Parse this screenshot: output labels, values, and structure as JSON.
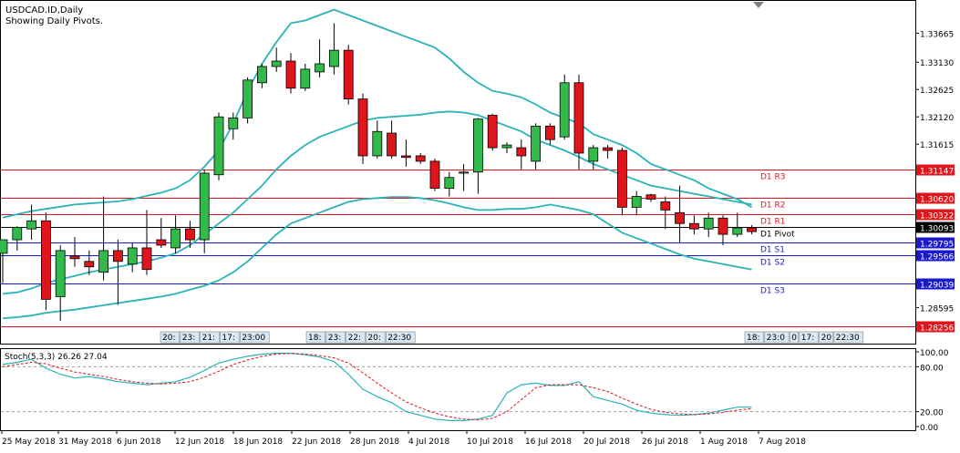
{
  "header": {
    "symbol_line": "USDCAD.ID,Daily",
    "sub_line": "Showing Daily Pivots."
  },
  "colors": {
    "bull": "#31b94a",
    "bear": "#e0141b",
    "band": "#2ab3b8",
    "resistance": "#e0141b",
    "support": "#1a1acc",
    "pivot": "#000000",
    "stoch_main": "#2ab3b8",
    "stoch_signal": "#e0141b"
  },
  "price_axis": {
    "ticks": [
      "1.33665",
      "1.33130",
      "1.32625",
      "1.32120",
      "1.31615",
      "1.28595"
    ]
  },
  "pivots": [
    {
      "name": "D1 R3",
      "value": "1.31147",
      "kind": "resistance"
    },
    {
      "name": "D1 R2",
      "value": "1.30620",
      "kind": "resistance"
    },
    {
      "name": "D1 R1",
      "value": "1.30322",
      "kind": "resistance"
    },
    {
      "name": "D1 Pivot",
      "value": "1.30093",
      "kind": "pivot"
    },
    {
      "name": "D1 S1",
      "value": "1.29795",
      "kind": "support"
    },
    {
      "name": "D1 S2",
      "value": "1.29566",
      "kind": "support"
    },
    {
      "name": "D1 S3",
      "value": "1.29039",
      "kind": "support"
    },
    {
      "name": "",
      "value": "1.28256",
      "kind": "resistance"
    }
  ],
  "session_labels_left": [
    "20:",
    "23:",
    "21:",
    "17:",
    "23:00"
  ],
  "session_labels_mid": [
    "18:",
    "23:",
    "22:",
    "20:",
    "22:30"
  ],
  "session_labels_right": [
    "18:",
    "23:0",
    "0",
    "17:",
    "20",
    "22:30"
  ],
  "stochastic": {
    "title": "Stoch(5,3,3) 26.26 27.04",
    "axis_ticks": [
      "100.00",
      "80.00",
      "20.00",
      "0.00"
    ]
  },
  "date_axis": {
    "labels": [
      "25 May 2018",
      "31 May 2018",
      "6 Jun 2018",
      "12 Jun 2018",
      "18 Jun 2018",
      "22 Jun 2018",
      "28 Jun 2018",
      "4 Jul 2018",
      "10 Jul 2018",
      "16 Jul 2018",
      "20 Jul 2018",
      "26 Jul 2018",
      "1 Aug 2018",
      "7 Aug 2018"
    ]
  },
  "chart_data": {
    "type": "candlestick",
    "symbol": "USDCAD.ID",
    "timeframe": "Daily",
    "candles": [
      {
        "o": 1.296,
        "h": 1.2985,
        "l": 1.2905,
        "c": 1.2985
      },
      {
        "o": 1.2985,
        "h": 1.301,
        "l": 1.2965,
        "c": 1.3008
      },
      {
        "o": 1.3005,
        "h": 1.305,
        "l": 1.2985,
        "c": 1.302
      },
      {
        "o": 1.302,
        "h": 1.3035,
        "l": 1.2855,
        "c": 1.2875
      },
      {
        "o": 1.288,
        "h": 1.2975,
        "l": 1.2835,
        "c": 1.2965
      },
      {
        "o": 1.2955,
        "h": 1.299,
        "l": 1.2935,
        "c": 1.295
      },
      {
        "o": 1.2945,
        "h": 1.2965,
        "l": 1.292,
        "c": 1.2935
      },
      {
        "o": 1.2925,
        "h": 1.3065,
        "l": 1.291,
        "c": 1.2965
      },
      {
        "o": 1.2965,
        "h": 1.2985,
        "l": 1.2865,
        "c": 1.2945
      },
      {
        "o": 1.294,
        "h": 1.298,
        "l": 1.2925,
        "c": 1.297
      },
      {
        "o": 1.297,
        "h": 1.304,
        "l": 1.292,
        "c": 1.293
      },
      {
        "o": 1.2985,
        "h": 1.3025,
        "l": 1.297,
        "c": 1.2975
      },
      {
        "o": 1.297,
        "h": 1.303,
        "l": 1.296,
        "c": 1.3005
      },
      {
        "o": 1.3005,
        "h": 1.302,
        "l": 1.297,
        "c": 1.2985
      },
      {
        "o": 1.2985,
        "h": 1.3115,
        "l": 1.296,
        "c": 1.3108
      },
      {
        "o": 1.3105,
        "h": 1.322,
        "l": 1.3095,
        "c": 1.3212
      },
      {
        "o": 1.319,
        "h": 1.322,
        "l": 1.317,
        "c": 1.321
      },
      {
        "o": 1.321,
        "h": 1.3285,
        "l": 1.32,
        "c": 1.328
      },
      {
        "o": 1.3275,
        "h": 1.331,
        "l": 1.3265,
        "c": 1.3305
      },
      {
        "o": 1.3305,
        "h": 1.334,
        "l": 1.3295,
        "c": 1.3315
      },
      {
        "o": 1.3315,
        "h": 1.333,
        "l": 1.3255,
        "c": 1.3265
      },
      {
        "o": 1.3265,
        "h": 1.331,
        "l": 1.326,
        "c": 1.33
      },
      {
        "o": 1.3295,
        "h": 1.3355,
        "l": 1.3285,
        "c": 1.331
      },
      {
        "o": 1.3305,
        "h": 1.3385,
        "l": 1.329,
        "c": 1.3335
      },
      {
        "o": 1.3335,
        "h": 1.3345,
        "l": 1.3235,
        "c": 1.3245
      },
      {
        "o": 1.3245,
        "h": 1.3255,
        "l": 1.3125,
        "c": 1.314
      },
      {
        "o": 1.314,
        "h": 1.3205,
        "l": 1.3135,
        "c": 1.3185
      },
      {
        "o": 1.3182,
        "h": 1.3205,
        "l": 1.3135,
        "c": 1.314
      },
      {
        "o": 1.314,
        "h": 1.317,
        "l": 1.312,
        "c": 1.3137
      },
      {
        "o": 1.314,
        "h": 1.3145,
        "l": 1.3125,
        "c": 1.313
      },
      {
        "o": 1.313,
        "h": 1.3135,
        "l": 1.3075,
        "c": 1.308
      },
      {
        "o": 1.308,
        "h": 1.311,
        "l": 1.3065,
        "c": 1.31
      },
      {
        "o": 1.3108,
        "h": 1.3125,
        "l": 1.3075,
        "c": 1.311
      },
      {
        "o": 1.311,
        "h": 1.321,
        "l": 1.307,
        "c": 1.3208
      },
      {
        "o": 1.3215,
        "h": 1.3218,
        "l": 1.315,
        "c": 1.3155
      },
      {
        "o": 1.3155,
        "h": 1.3165,
        "l": 1.3145,
        "c": 1.316
      },
      {
        "o": 1.3155,
        "h": 1.317,
        "l": 1.3115,
        "c": 1.314
      },
      {
        "o": 1.313,
        "h": 1.32,
        "l": 1.3115,
        "c": 1.3195
      },
      {
        "o": 1.3195,
        "h": 1.32,
        "l": 1.316,
        "c": 1.317
      },
      {
        "o": 1.3175,
        "h": 1.329,
        "l": 1.317,
        "c": 1.3275
      },
      {
        "o": 1.3275,
        "h": 1.329,
        "l": 1.3115,
        "c": 1.3145
      },
      {
        "o": 1.313,
        "h": 1.316,
        "l": 1.3115,
        "c": 1.3155
      },
      {
        "o": 1.3155,
        "h": 1.316,
        "l": 1.3135,
        "c": 1.315
      },
      {
        "o": 1.315,
        "h": 1.3155,
        "l": 1.303,
        "c": 1.3045
      },
      {
        "o": 1.3045,
        "h": 1.3075,
        "l": 1.303,
        "c": 1.3065
      },
      {
        "o": 1.3068,
        "h": 1.307,
        "l": 1.3055,
        "c": 1.306
      },
      {
        "o": 1.3055,
        "h": 1.3065,
        "l": 1.3005,
        "c": 1.304
      },
      {
        "o": 1.3035,
        "h": 1.3085,
        "l": 1.298,
        "c": 1.3015
      },
      {
        "o": 1.3015,
        "h": 1.303,
        "l": 1.2995,
        "c": 1.3005
      },
      {
        "o": 1.3005,
        "h": 1.3035,
        "l": 1.299,
        "c": 1.3025
      },
      {
        "o": 1.3025,
        "h": 1.303,
        "l": 1.2975,
        "c": 1.2995
      },
      {
        "o": 1.2995,
        "h": 1.3035,
        "l": 1.299,
        "c": 1.3007
      },
      {
        "o": 1.3007,
        "h": 1.3012,
        "l": 1.2995,
        "c": 1.3
      }
    ],
    "bollinger": {
      "upper": [
        1.3026,
        1.3032,
        1.3038,
        1.3042,
        1.3046,
        1.305,
        1.3052,
        1.3054,
        1.3056,
        1.306,
        1.3066,
        1.3072,
        1.308,
        1.3095,
        1.312,
        1.315,
        1.32,
        1.326,
        1.331,
        1.335,
        1.3385,
        1.339,
        1.34,
        1.341,
        1.34,
        1.339,
        1.338,
        1.337,
        1.336,
        1.335,
        1.334,
        1.332,
        1.3295,
        1.3275,
        1.326,
        1.3255,
        1.3248,
        1.3235,
        1.322,
        1.321,
        1.32,
        1.318,
        1.317,
        1.316,
        1.3145,
        1.3125,
        1.3115,
        1.3105,
        1.3095,
        1.308,
        1.307,
        1.306,
        1.3045
      ],
      "middle": [
        1.2885,
        1.2888,
        1.2895,
        1.2905,
        1.2912,
        1.2918,
        1.2925,
        1.293,
        1.2935,
        1.294,
        1.2945,
        1.2952,
        1.296,
        1.2975,
        1.2995,
        1.3015,
        1.3035,
        1.306,
        1.3085,
        1.3115,
        1.314,
        1.316,
        1.3175,
        1.3185,
        1.3195,
        1.3205,
        1.321,
        1.3212,
        1.3214,
        1.3216,
        1.322,
        1.3222,
        1.322,
        1.3215,
        1.3205,
        1.3195,
        1.3185,
        1.317,
        1.316,
        1.315,
        1.3138,
        1.3125,
        1.3115,
        1.3105,
        1.3095,
        1.3085,
        1.308,
        1.3075,
        1.307,
        1.3065,
        1.306,
        1.3055,
        1.305
      ],
      "lower": [
        1.284,
        1.2842,
        1.2845,
        1.285,
        1.2853,
        1.2856,
        1.286,
        1.2864,
        1.2868,
        1.2872,
        1.2876,
        1.288,
        1.2885,
        1.2893,
        1.29,
        1.291,
        1.2925,
        1.2945,
        1.297,
        1.2995,
        1.3015,
        1.3025,
        1.3035,
        1.3045,
        1.3055,
        1.306,
        1.3062,
        1.3064,
        1.3064,
        1.3062,
        1.3058,
        1.3052,
        1.3045,
        1.304,
        1.304,
        1.3042,
        1.3042,
        1.3045,
        1.305,
        1.3045,
        1.304,
        1.3032,
        1.3015,
        1.2998,
        1.2988,
        1.2978,
        1.2968,
        1.2958,
        1.295,
        1.2945,
        1.294,
        1.2935,
        1.293
      ]
    },
    "stochastic_series": {
      "k": [
        83,
        86,
        90,
        78,
        70,
        65,
        67,
        64,
        60,
        58,
        56,
        58,
        60,
        66,
        75,
        85,
        90,
        94,
        97,
        98,
        98,
        96,
        93,
        87,
        70,
        50,
        40,
        32,
        20,
        15,
        10,
        8,
        8,
        10,
        15,
        45,
        56,
        58,
        55,
        55,
        60,
        40,
        35,
        30,
        22,
        18,
        16,
        15,
        16,
        18,
        22,
        26,
        26
      ],
      "d": [
        80,
        83,
        86,
        84,
        78,
        73,
        70,
        67,
        63,
        60,
        58,
        57,
        58,
        60,
        66,
        74,
        83,
        89,
        94,
        97,
        98,
        97,
        95,
        92,
        85,
        72,
        58,
        45,
        33,
        25,
        18,
        13,
        10,
        9,
        11,
        20,
        36,
        52,
        56,
        56,
        56,
        52,
        47,
        38,
        30,
        23,
        19,
        17,
        16,
        17,
        19,
        22,
        24
      ],
      "levels": [
        20,
        80
      ]
    }
  }
}
